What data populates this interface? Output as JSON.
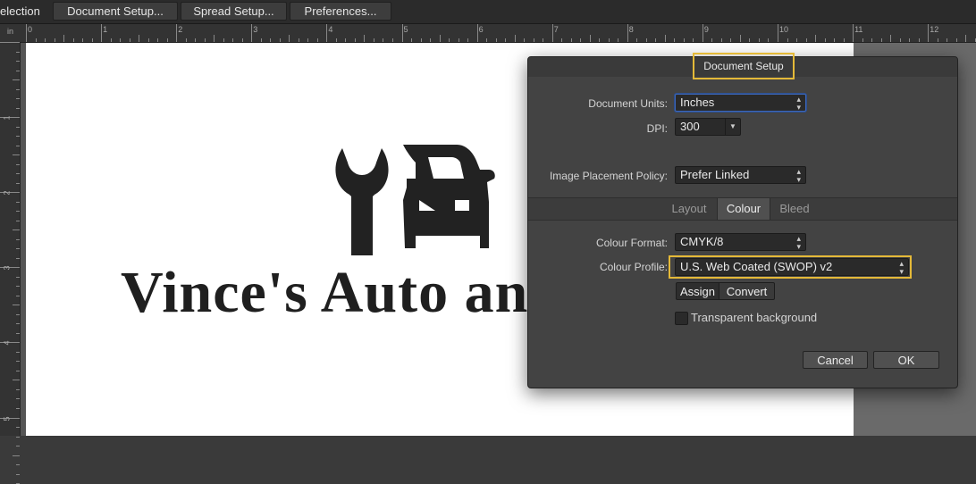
{
  "toolbar": {
    "selection_label": "election",
    "document_setup": "Document Setup...",
    "spread_setup": "Spread Setup...",
    "preferences": "Preferences..."
  },
  "ruler": {
    "unit": "in",
    "h_labels": [
      "0",
      "1",
      "2",
      "3",
      "4",
      "5",
      "6",
      "7",
      "8",
      "9",
      "10",
      "11",
      "12"
    ],
    "v_labels": [
      "1",
      "2",
      "3",
      "4",
      "5"
    ]
  },
  "canvas": {
    "logo_text": "Vince's Auto and"
  },
  "dialog": {
    "title": "Document Setup",
    "document_units_label": "Document Units:",
    "document_units_value": "Inches",
    "dpi_label": "DPI:",
    "dpi_value": "300",
    "image_policy_label": "Image Placement Policy:",
    "image_policy_value": "Prefer Linked",
    "tabs": [
      "Layout",
      "Colour",
      "Bleed"
    ],
    "active_tab": "Colour",
    "colour_format_label": "Colour Format:",
    "colour_format_value": "CMYK/8",
    "colour_profile_label": "Colour Profile:",
    "colour_profile_value": "U.S. Web Coated (SWOP) v2",
    "assign": "Assign",
    "convert": "Convert",
    "transparent_bg": "Transparent background",
    "cancel": "Cancel",
    "ok": "OK"
  },
  "colors": {
    "highlight": "#e4b938",
    "focus": "#3d67b8"
  }
}
